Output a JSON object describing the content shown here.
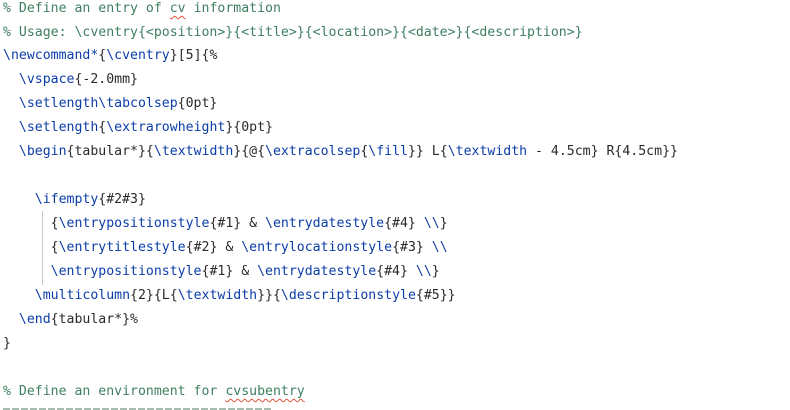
{
  "editor": {
    "lines": [
      [
        "% Define an entry of ",
        "cv",
        " information"
      ],
      [
        "% Usage: \\cventry{<position>}{<title>}{<location>}{<date>}{<description>}"
      ],
      [
        "\\newcommand*",
        "{",
        "\\cventry",
        "}[5]{%"
      ],
      [
        "  \\vspace",
        "{-2.0mm}"
      ],
      [
        "  \\setlength\\tabcolsep",
        "{0pt}"
      ],
      [
        "  \\setlength",
        "{",
        "\\extrarowheight",
        "}{0pt}"
      ],
      [
        "  \\begin",
        "{tabular*}{",
        "\\textwidth",
        "}{@{",
        "\\extracolsep",
        "{",
        "\\fill",
        "}} L{",
        "\\textwidth",
        " - 4.5cm} R{4.5cm}}"
      ],
      [
        ""
      ],
      [
        "    \\ifempty",
        "{#2#3}"
      ],
      [
        "      {",
        "\\entrypositionstyle",
        "{#1} & ",
        "\\entrydatestyle",
        "{#4} ",
        "\\\\",
        "}"
      ],
      [
        "      {",
        "\\entrytitlestyle",
        "{#2} & ",
        "\\entrylocationstyle",
        "{#3} ",
        "\\\\"
      ],
      [
        "      ",
        "\\entrypositionstyle",
        "{#1} & ",
        "\\entrydatestyle",
        "{#4} ",
        "\\\\",
        "}"
      ],
      [
        "    \\multicolumn",
        "{2}{L{",
        "\\textwidth",
        "}}{",
        "\\descriptionstyle",
        "{#5}}"
      ],
      [
        "  \\end",
        "{tabular*}%"
      ],
      [
        "}"
      ],
      [
        ""
      ],
      [
        "% Define an environment for ",
        "cvsubentry"
      ]
    ]
  }
}
